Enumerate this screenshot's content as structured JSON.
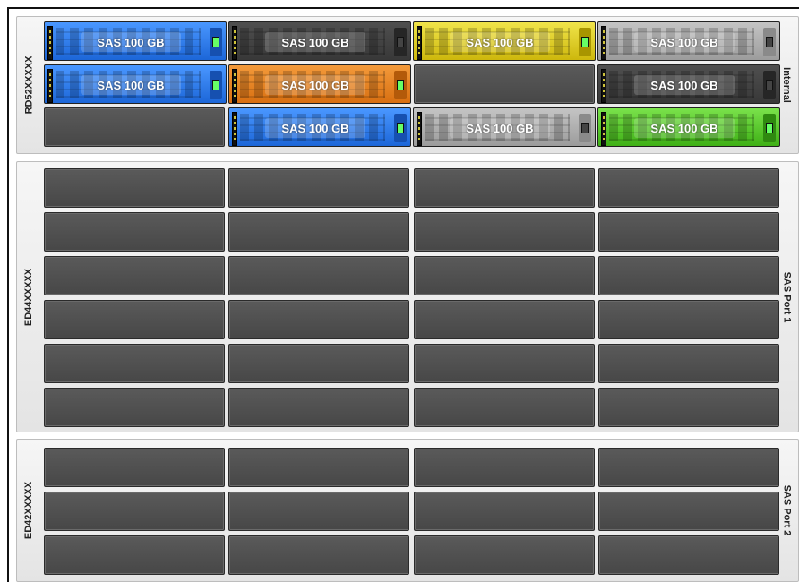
{
  "enclosures": [
    {
      "model": "RD52XXXXX",
      "port": "Internal",
      "drives": [
        {
          "label": "SAS 100 GB",
          "color": "blue",
          "led": "on"
        },
        {
          "label": "SAS 100 GB",
          "color": "dark",
          "led": "off"
        },
        {
          "label": "SAS 100 GB",
          "color": "yellow",
          "led": "on"
        },
        {
          "label": "SAS 100 GB",
          "color": "silver",
          "led": "off"
        },
        {
          "label": "SAS 100 GB",
          "color": "blue",
          "led": "on"
        },
        {
          "label": "SAS 100 GB",
          "color": "orange",
          "led": "on"
        },
        {
          "label": "SAS 100 GB",
          "color": "dark",
          "led": "off"
        },
        {
          "label": "SAS 100 GB",
          "color": "blue",
          "led": "on"
        },
        {
          "label": "SAS 100 GB",
          "color": "silver",
          "led": "off"
        },
        {
          "label": "SAS 100 GB",
          "color": "green",
          "led": "on"
        }
      ],
      "empty_slots": 2
    },
    {
      "model": "ED44XXXXX",
      "port": "SAS Port 1",
      "drives": [],
      "empty_slots": 24
    },
    {
      "model": "ED42XXXXX",
      "port": "SAS Port 2",
      "drives": [],
      "empty_slots": 12
    }
  ],
  "colors": {
    "blue": "#2a78f0",
    "dark": "#444444",
    "yellow": "#e0cf2a",
    "silver": "#b0b0b0",
    "orange": "#e9821f",
    "green": "#5ccc2c",
    "empty_slot": "#4f4f4f"
  }
}
